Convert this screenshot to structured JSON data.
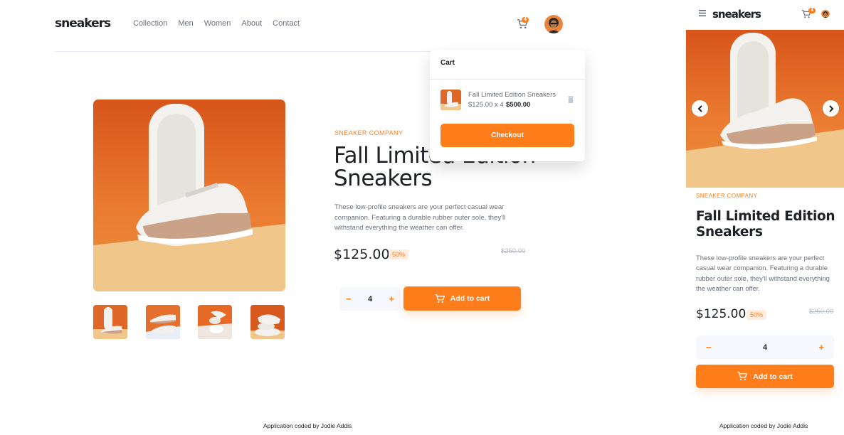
{
  "brand": {
    "logo_text": "sneakers",
    "accent": "#ff7e1b",
    "accent_light": "#ffede0"
  },
  "nav": {
    "items": [
      "Collection",
      "Men",
      "Women",
      "About",
      "Contact"
    ]
  },
  "cart_badge": "4",
  "icons": {
    "cart": "cart-icon",
    "avatar": "avatar",
    "menu": "hamburger-icon",
    "trash": "trash-icon",
    "prev": "chevron-left-icon",
    "next": "chevron-right-icon"
  },
  "product": {
    "company": "SNEAKER COMPANY",
    "title": "Fall Limited Edition Sneakers",
    "description": "These low-profile sneakers are your perfect casual wear companion. Featuring a durable rubber outer sole, they'll withstand everything the weather can offer.",
    "price": "$125.00",
    "discount": "50%",
    "old_price": "$250.00",
    "quantity": "4",
    "minus": "−",
    "plus": "+",
    "add_to_cart": "Add to cart"
  },
  "cart": {
    "heading": "Cart",
    "item_name": "Fall Limited Edition Sneakers",
    "item_calc": "$125.00 x 4",
    "item_total": "$500.00",
    "checkout": "Checkout"
  },
  "attribution": "Application coded by Jodie Addis"
}
